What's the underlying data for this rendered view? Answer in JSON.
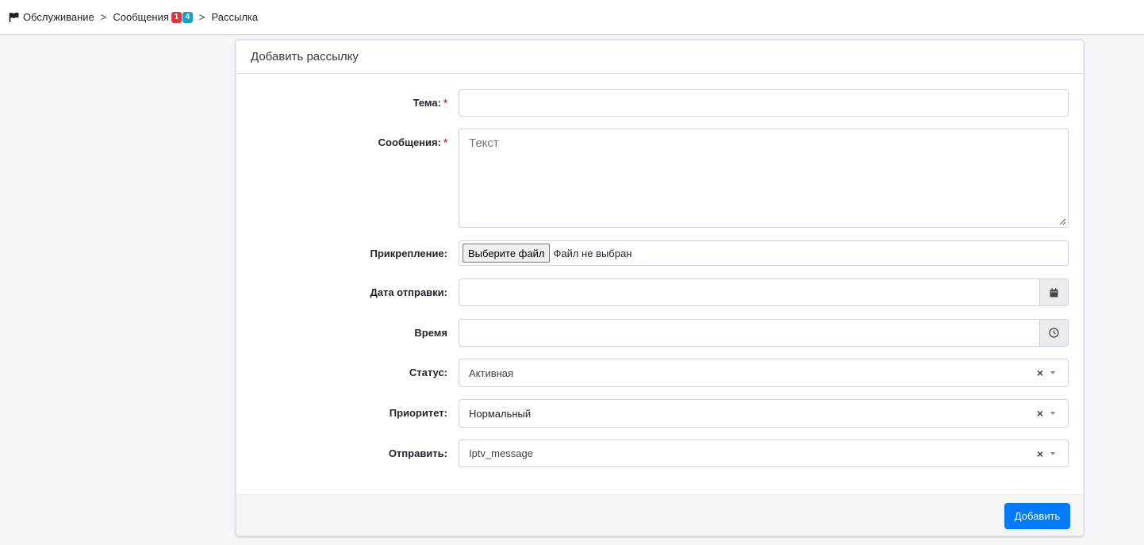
{
  "breadcrumb": {
    "items": [
      {
        "label": "Обслуживание"
      },
      {
        "label": "Сообщения",
        "badges": [
          "1",
          "4"
        ]
      },
      {
        "label": "Рассылка"
      }
    ],
    "separator": ">"
  },
  "card": {
    "title": "Добавить рассылку",
    "fields": {
      "subject": {
        "label": "Тема:",
        "required_mark": "*",
        "value": ""
      },
      "message": {
        "label": "Сообщения:",
        "required_mark": "*",
        "placeholder": "Текст",
        "value": ""
      },
      "attachment": {
        "label": "Прикрепление:",
        "button_label": "Выберите файл",
        "status": "Файл не выбран"
      },
      "send_date": {
        "label": "Дата отправки:",
        "value": "",
        "icon": "calendar-icon"
      },
      "time": {
        "label": "Время",
        "value": "",
        "icon": "clock-icon"
      },
      "status": {
        "label": "Статус:",
        "value": "Активная",
        "clear": "×"
      },
      "priority": {
        "label": "Приоритет:",
        "value": "Нормальный",
        "clear": "×"
      },
      "send_to": {
        "label": "Отправить:",
        "value": "Iptv_message",
        "clear": "×"
      }
    },
    "submit_label": "Добавить"
  },
  "colors": {
    "primary": "#007bff",
    "badge_red": "#dc3545",
    "badge_teal": "#17a2b8",
    "required": "#dc3545",
    "page_bg": "#f4f6f9"
  }
}
